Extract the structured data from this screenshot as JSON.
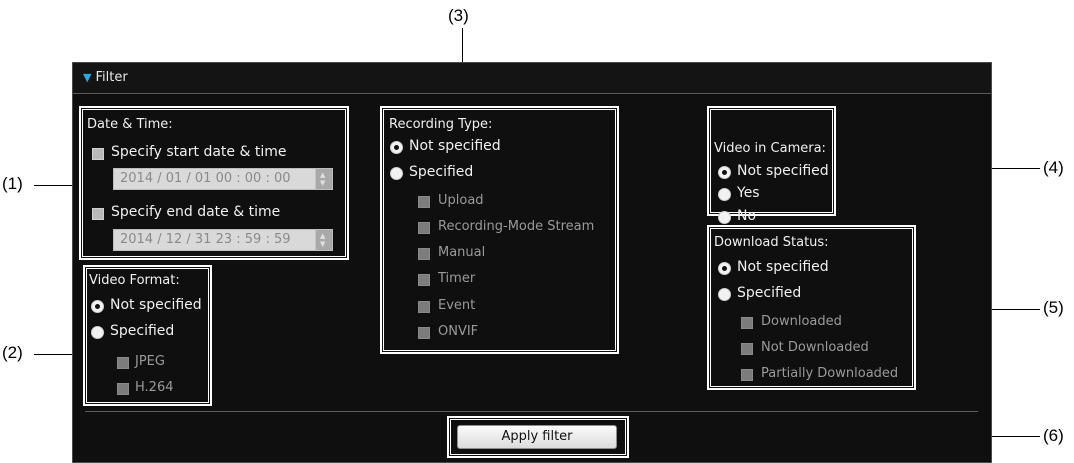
{
  "callouts": {
    "c1": "(1)",
    "c2": "(2)",
    "c3": "(3)",
    "c4": "(4)",
    "c5": "(5)",
    "c6": "(6)"
  },
  "filter": {
    "title": "Filter",
    "date_time": {
      "heading": "Date & Time:",
      "start_label": "Specify start date & time",
      "start_value": "2014 / 01 / 01 00 : 00 : 00",
      "end_label": "Specify end date & time",
      "end_value": "2014 / 12 / 31 23 : 59 : 59"
    },
    "video_format": {
      "heading": "Video Format:",
      "not_specified": "Not specified",
      "specified": "Specified",
      "options": [
        "JPEG",
        "H.264"
      ]
    },
    "recording_type": {
      "heading": "Recording Type:",
      "not_specified": "Not specified",
      "specified": "Specified",
      "options": [
        "Upload",
        "Recording-Mode Stream",
        "Manual",
        "Timer",
        "Event",
        "ONVIF"
      ]
    },
    "video_in_camera": {
      "heading": "Video in Camera:",
      "not_specified": "Not specified",
      "yes": "Yes",
      "no": "No"
    },
    "download_status": {
      "heading": "Download Status:",
      "not_specified": "Not specified",
      "specified": "Specified",
      "options": [
        "Downloaded",
        "Not Downloaded",
        "Partially Downloaded"
      ]
    },
    "apply_label": "Apply filter"
  },
  "colors": {
    "accent": "#2aa8e0",
    "panel_bg": "#0f0f0f"
  }
}
